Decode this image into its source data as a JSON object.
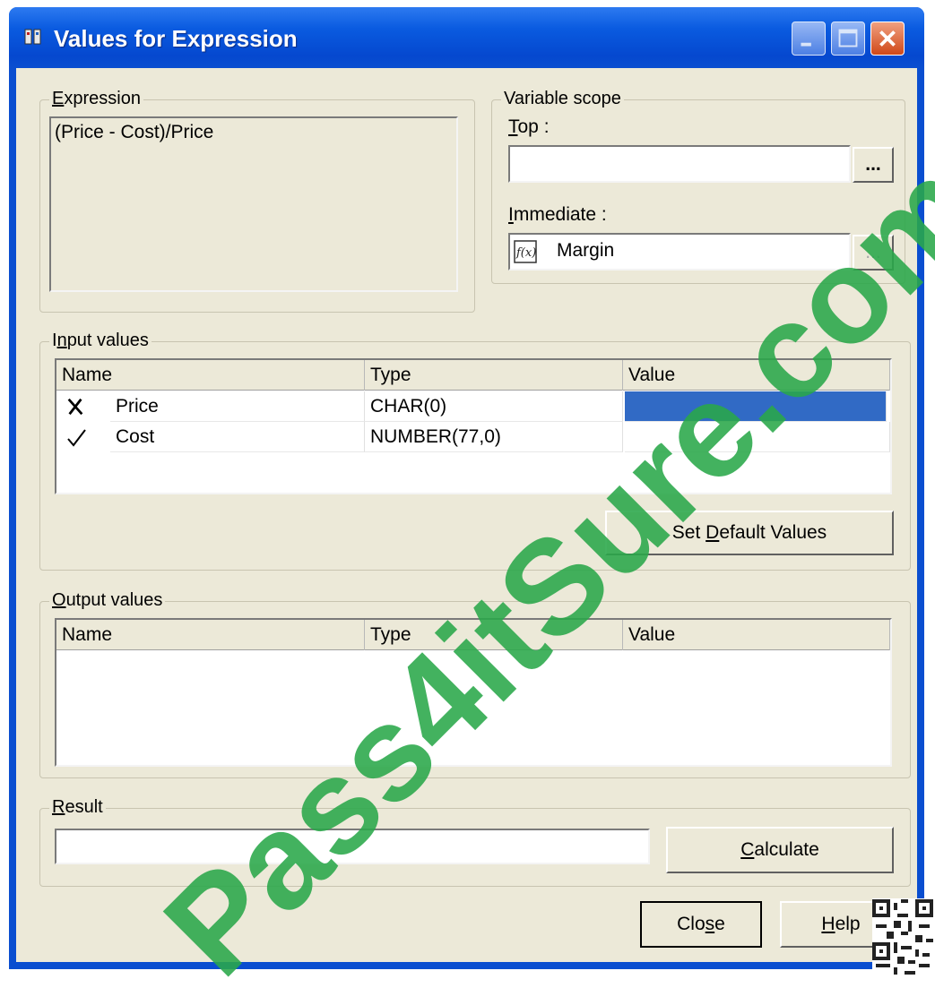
{
  "window": {
    "title": "Values for Expression"
  },
  "expression": {
    "group_label_u": "E",
    "group_label_rest": "xpression",
    "text": "(Price - Cost)/Price"
  },
  "variable_scope": {
    "group_label": "Variable scope",
    "top_label_u": "T",
    "top_label_rest": "op :",
    "top_value": "",
    "top_browse_label": "...",
    "immediate_label_u": "I",
    "immediate_label_rest": "mmediate :",
    "immediate_value": "Margin",
    "immediate_browse_label": "...",
    "immediate_icon": "function-icon"
  },
  "input_values": {
    "group_label_pre": "I",
    "group_label_u": "n",
    "group_label_rest": "put values",
    "columns": [
      "Name",
      "Type",
      "Value"
    ],
    "rows": [
      {
        "status_icon": "x-icon",
        "name": "Price",
        "type": "CHAR(0)",
        "value": "",
        "selected": true
      },
      {
        "status_icon": "check-icon",
        "name": "Cost",
        "type": "NUMBER(77,0)",
        "value": ""
      }
    ],
    "set_default_pre": "Set ",
    "set_default_u": "D",
    "set_default_rest": "efault Values"
  },
  "output_values": {
    "group_label_u": "O",
    "group_label_rest": "utput values",
    "columns": [
      "Name",
      "Type",
      "Value"
    ]
  },
  "result": {
    "group_label_u": "R",
    "group_label_rest": "esult",
    "value": "",
    "calculate_u": "C",
    "calculate_rest": "alculate"
  },
  "footer": {
    "close_pre": "Clo",
    "close_u": "s",
    "close_rest": "e",
    "help_u": "H",
    "help_rest": "elp"
  },
  "watermark": "Pass4itSure.com",
  "colors": {
    "titlebar": "#0a4ed0",
    "dialog_bg": "#ece9d8",
    "selection": "#316ac5",
    "watermark": "#2aa84a"
  }
}
